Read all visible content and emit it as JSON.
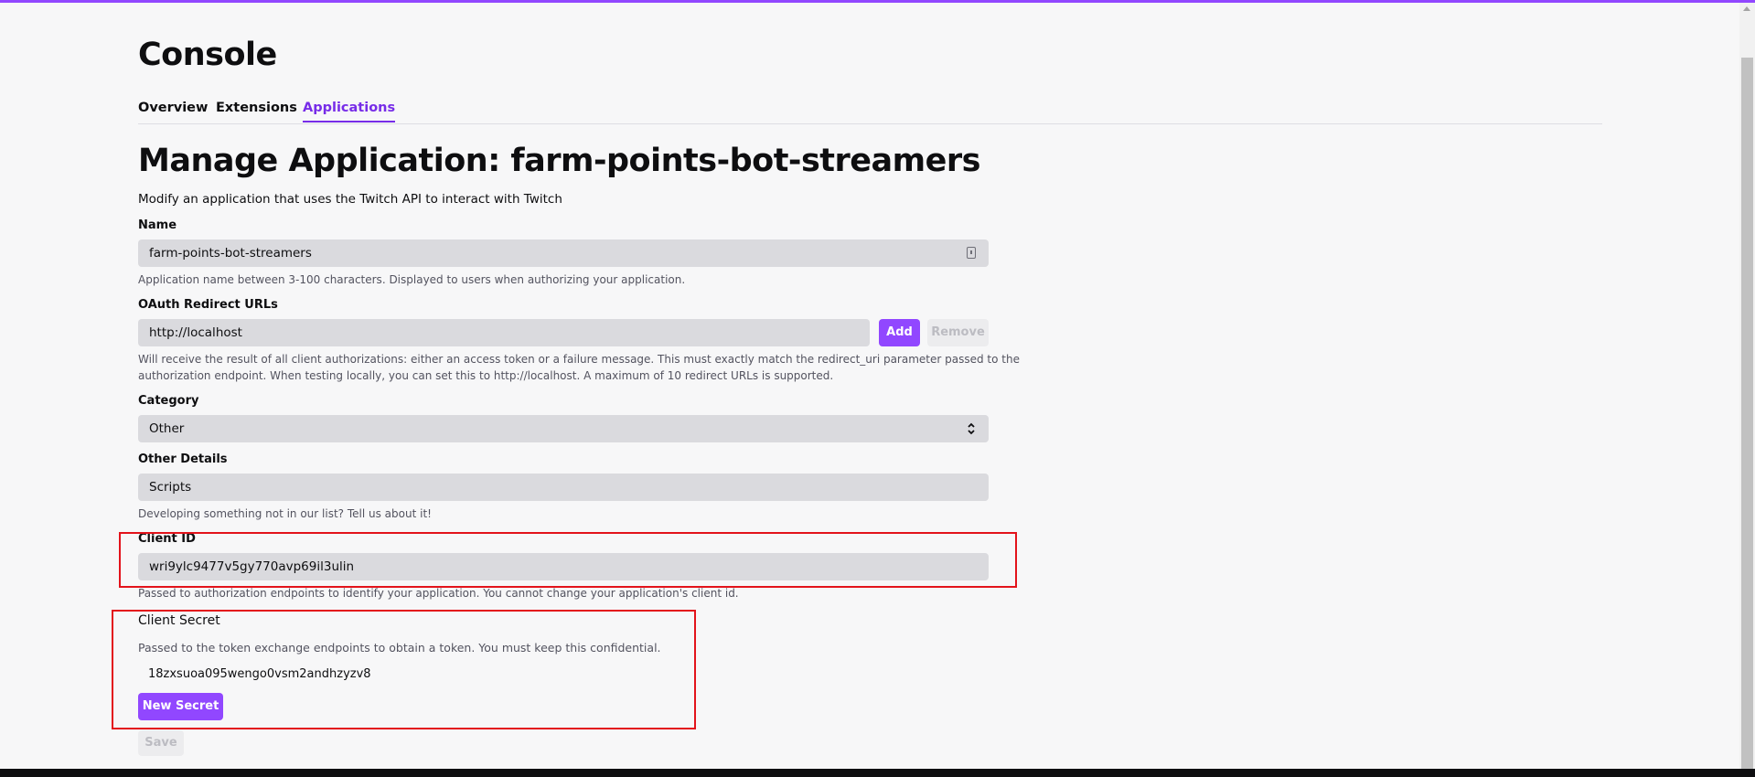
{
  "header": {
    "title": "Console"
  },
  "tabs": [
    {
      "label": "Overview"
    },
    {
      "label": "Extensions"
    },
    {
      "label": "Applications",
      "active": true
    }
  ],
  "page": {
    "heading": "Manage Application: farm-points-bot-streamers",
    "subtitle": "Modify an application that uses the Twitch API to interact with Twitch"
  },
  "form": {
    "name": {
      "label": "Name",
      "value": "farm-points-bot-streamers",
      "hint": "Application name between 3-100 characters. Displayed to users when authorizing your application."
    },
    "redirect": {
      "label": "OAuth Redirect URLs",
      "value": "http://localhost",
      "add_label": "Add",
      "remove_label": "Remove",
      "hint_line1": "Will receive the result of all client authorizations: either an access token or a failure message. This must exactly match the redirect_uri parameter passed to the",
      "hint_line2": "authorization endpoint. When testing locally, you can set this to http://localhost. A maximum of 10 redirect URLs is supported."
    },
    "category": {
      "label": "Category",
      "value": "Other"
    },
    "other_details": {
      "label": "Other Details",
      "value": "Scripts",
      "hint": "Developing something not in our list? Tell us about it!"
    },
    "client_id": {
      "label": "Client ID",
      "value": "wri9ylc9477v5gy770avp69il3ulin",
      "hint": "Passed to authorization endpoints to identify your application. You cannot change your application's client id."
    },
    "client_secret": {
      "label": "Client Secret",
      "hint": "Passed to the token exchange endpoints to obtain a token. You must keep this confidential.",
      "value": "18zxsuoa095wengo0vsm2andhzyzv8",
      "new_secret_label": "New Secret"
    },
    "save_label": "Save"
  },
  "colors": {
    "accent": "#9147ff",
    "active_tab": "#772ce8",
    "highlight_box": "#e3131b"
  },
  "icons": {
    "name_field": "contact-card-icon",
    "category_select": "chevron-updown-icon"
  }
}
